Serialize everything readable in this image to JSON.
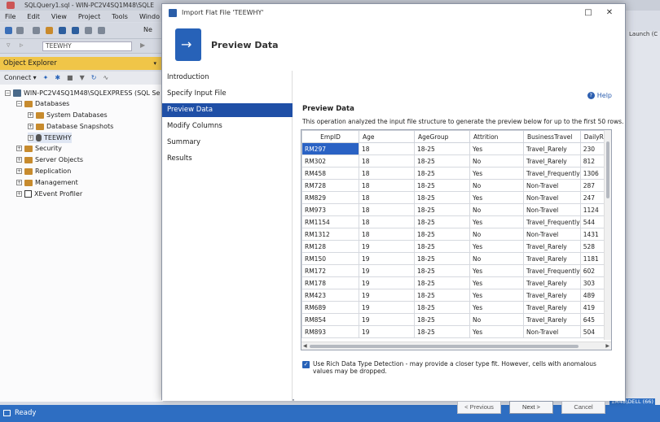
{
  "ssms": {
    "window_title": "SQLQuery1.sql - WIN-PC2V4SQ1M48\\SQLE",
    "menu": [
      "File",
      "Edit",
      "View",
      "Project",
      "Tools",
      "Windo"
    ],
    "db_combo": "TEEWHY",
    "toolbar_new_label": "Ne",
    "object_explorer": {
      "title": "Object Explorer",
      "connect_label": "Connect",
      "tree": {
        "server": "WIN-PC2V4SQ1M48\\SQLEXPRESS (SQL Se",
        "databases": "Databases",
        "system_databases": "System Databases",
        "database_snapshots": "Database Snapshots",
        "teewhy": "TEEWHY",
        "security": "Security",
        "server_objects": "Server Objects",
        "replication": "Replication",
        "management": "Management",
        "xevent_profiler": "XEvent Profiler"
      }
    },
    "status": "Ready",
    "launch_label": "Launch (C",
    "user_label": "1M48\\DELL (66)"
  },
  "dialog": {
    "title": "Import Flat File 'TEEWHY'",
    "header_title": "Preview Data",
    "nav": [
      "Introduction",
      "Specify Input File",
      "Preview Data",
      "Modify Columns",
      "Summary",
      "Results"
    ],
    "active_nav": "Preview Data",
    "help_label": "Help",
    "section_title": "Preview Data",
    "section_desc": "This operation analyzed the input file structure to generate the preview below for up to the first 50 rows.",
    "columns": [
      "EmpID",
      "Age",
      "AgeGroup",
      "Attrition",
      "BusinessTravel",
      "DailyRa"
    ],
    "rows": [
      [
        "RM297",
        "18",
        "18-25",
        "Yes",
        "Travel_Rarely",
        "230"
      ],
      [
        "RM302",
        "18",
        "18-25",
        "No",
        "Travel_Rarely",
        "812"
      ],
      [
        "RM458",
        "18",
        "18-25",
        "Yes",
        "Travel_Frequently",
        "1306"
      ],
      [
        "RM728",
        "18",
        "18-25",
        "No",
        "Non-Travel",
        "287"
      ],
      [
        "RM829",
        "18",
        "18-25",
        "Yes",
        "Non-Travel",
        "247"
      ],
      [
        "RM973",
        "18",
        "18-25",
        "No",
        "Non-Travel",
        "1124"
      ],
      [
        "RM1154",
        "18",
        "18-25",
        "Yes",
        "Travel_Frequently",
        "544"
      ],
      [
        "RM1312",
        "18",
        "18-25",
        "No",
        "Non-Travel",
        "1431"
      ],
      [
        "RM128",
        "19",
        "18-25",
        "Yes",
        "Travel_Rarely",
        "528"
      ],
      [
        "RM150",
        "19",
        "18-25",
        "No",
        "Travel_Rarely",
        "1181"
      ],
      [
        "RM172",
        "19",
        "18-25",
        "Yes",
        "Travel_Frequently",
        "602"
      ],
      [
        "RM178",
        "19",
        "18-25",
        "Yes",
        "Travel_Rarely",
        "303"
      ],
      [
        "RM423",
        "19",
        "18-25",
        "Yes",
        "Travel_Rarely",
        "489"
      ],
      [
        "RM689",
        "19",
        "18-25",
        "Yes",
        "Travel_Rarely",
        "419"
      ],
      [
        "RM854",
        "19",
        "18-25",
        "No",
        "Travel_Rarely",
        "645"
      ],
      [
        "RM893",
        "19",
        "18-25",
        "Yes",
        "Non-Travel",
        "504"
      ]
    ],
    "rich_detect_text": "Use Rich Data Type Detection - may provide a closer type fit. However, cells with anomalous values may be dropped.",
    "rich_detect_checked": true,
    "buttons": {
      "previous": "< Previous",
      "next": "Next >",
      "cancel": "Cancel"
    },
    "accent": "#1f4fa6"
  }
}
